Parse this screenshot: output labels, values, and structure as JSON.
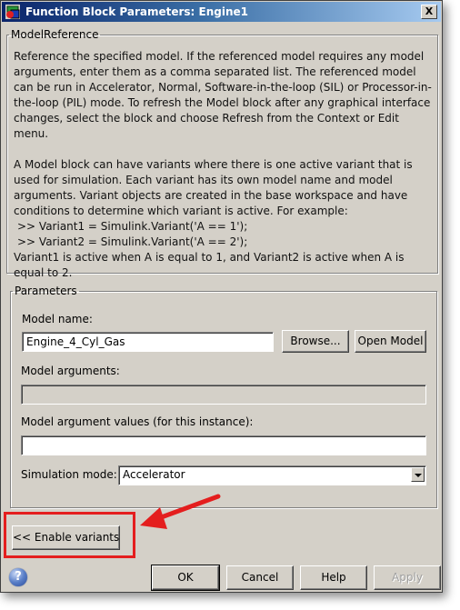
{
  "window": {
    "title": "Function Block Parameters: Engine1",
    "close_label": "X"
  },
  "model_reference": {
    "legend": "ModelReference",
    "paragraph1": "Reference the specified model.  If the referenced model requires any model arguments, enter them as a comma separated list.  The referenced model can be run in Accelerator, Normal, Software-in-the-loop (SIL) or Processor-in-the-loop (PIL) mode.  To refresh the Model block after any graphical interface changes, select the block and choose Refresh from the Context or Edit menu.",
    "paragraph2": "A Model block can have variants where there is one active variant that is used for simulation. Each variant has its own model name and model arguments. Variant objects are created in the base workspace and have conditions to determine which variant is active. For example:",
    "code_line1": ">> Variant1 = Simulink.Variant('A == 1');",
    "code_line2": ">> Variant2 = Simulink.Variant('A == 2');",
    "paragraph3": "Variant1 is active when A is equal to 1, and Variant2 is active when A is equal to 2."
  },
  "parameters": {
    "legend": "Parameters",
    "model_name_label": "Model name:",
    "model_name_value": "Engine_4_Cyl_Gas",
    "browse_label": "Browse...",
    "open_model_label": "Open Model",
    "model_arguments_label": "Model arguments:",
    "model_arguments_value": "",
    "model_argument_values_label": "Model argument values (for this instance):",
    "model_argument_values_value": "",
    "simulation_mode_label": "Simulation mode:",
    "simulation_mode_value": "Accelerator"
  },
  "enable_variants_label": "<< Enable variants",
  "footer": {
    "ok_label": "OK",
    "cancel_label": "Cancel",
    "help_label": "Help",
    "apply_label": "Apply",
    "help_icon_glyph": "?"
  },
  "annotation": {
    "color": "#e41e1e"
  }
}
